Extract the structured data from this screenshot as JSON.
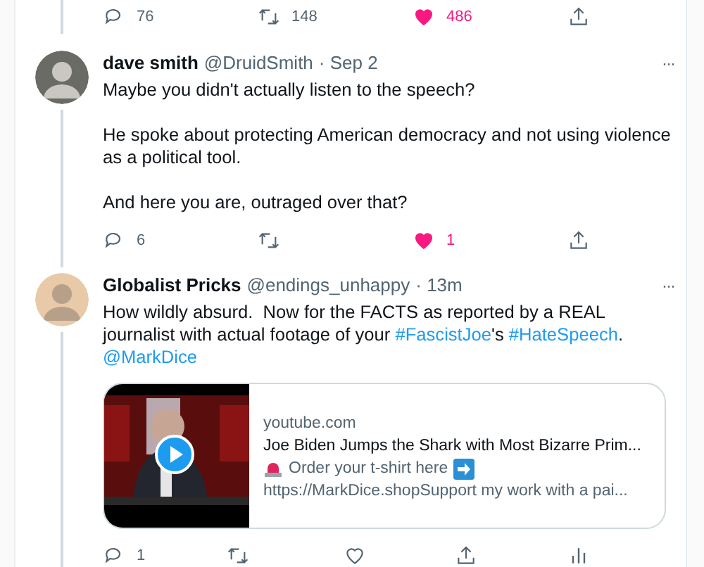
{
  "top_actions": [
    {
      "kind": "reply",
      "count": "76"
    },
    {
      "kind": "retweet",
      "count": "148"
    },
    {
      "kind": "like",
      "count": "486",
      "liked": true
    },
    {
      "kind": "share"
    }
  ],
  "tweets": [
    {
      "name": "dave smith",
      "handle": "@DruidSmith",
      "time": "· Sep 2",
      "more": "···",
      "paragraphs": [
        [
          {
            "kind": "plain",
            "text": "Maybe you didn't actually listen to the speech?"
          }
        ],
        [
          {
            "kind": "plain",
            "text": "He spoke about protecting American democracy and not using violence as a political tool."
          }
        ],
        [
          {
            "kind": "plain",
            "text": "And here you are, outraged over that?"
          }
        ]
      ],
      "actions": [
        {
          "kind": "reply",
          "count": "6"
        },
        {
          "kind": "retweet"
        },
        {
          "kind": "like",
          "count": "1",
          "liked": true
        },
        {
          "kind": "share"
        }
      ]
    },
    {
      "name": "Globalist Pricks",
      "handle": "@endings_unhappy",
      "time": "· 13m",
      "more": "···",
      "paragraphs": [
        [
          {
            "kind": "plain",
            "text": "How wildly absurd.  Now for the FACTS as reported by a REAL journalist with actual footage of your "
          },
          {
            "kind": "link",
            "text": "#FascistJoe"
          },
          {
            "kind": "plain",
            "text": "'s "
          },
          {
            "kind": "link",
            "text": "#HateSpeech"
          },
          {
            "kind": "plain",
            "text": ".  "
          },
          {
            "kind": "link",
            "text": "@MarkDice"
          }
        ]
      ],
      "card": {
        "kind": "picture",
        "site": "youtube.com",
        "title": "Joe Biden Jumps the Shark with Most Bizarre Prim...",
        "lines": [
          {
            "kind": "siren-arrow",
            "text": "Order your t-shirt here"
          },
          {
            "kind": "plain",
            "text": "https://MarkDice.shopSupport my work with a pai..."
          }
        ]
      },
      "actions": [
        {
          "kind": "reply",
          "count": "1"
        },
        {
          "kind": "retweet"
        },
        {
          "kind": "like",
          "liked": false
        },
        {
          "kind": "share"
        },
        {
          "kind": "analytics"
        }
      ]
    }
  ]
}
